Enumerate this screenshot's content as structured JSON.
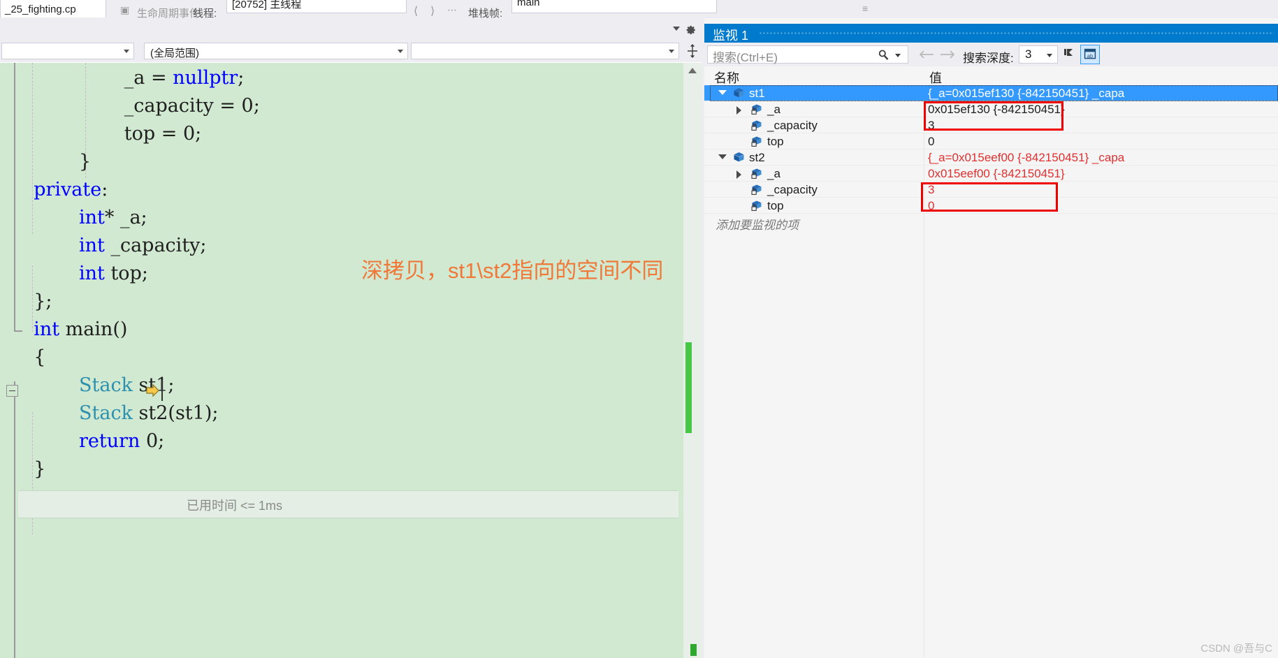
{
  "toolbar": {
    "tab_label": "_25_fighting.cp",
    "auto_window_label": "生命周期事件",
    "thread_label": "线程:",
    "thread_value": "[20752] 主线程",
    "stack_label": "堆栈帧:",
    "stack_value": "main",
    "scope_left": "",
    "scope_global": "(全局范围)",
    "scope_right": ""
  },
  "editor": {
    "lines": [
      {
        "indent": 9,
        "segments": [
          {
            "t": "_a = ",
            "c": "ident"
          },
          {
            "t": "nullptr",
            "c": "kw"
          },
          {
            "t": ";",
            "c": "ident"
          }
        ]
      },
      {
        "indent": 9,
        "segments": [
          {
            "t": "_capacity = 0;",
            "c": "ident"
          }
        ]
      },
      {
        "indent": 9,
        "segments": [
          {
            "t": "top = 0;",
            "c": "ident"
          }
        ]
      },
      {
        "indent": 5,
        "segments": [
          {
            "t": "}",
            "c": "ident"
          }
        ]
      },
      {
        "indent": 1,
        "segments": [
          {
            "t": "private",
            "c": "kw"
          },
          {
            "t": ":",
            "c": "ident"
          }
        ]
      },
      {
        "indent": 5,
        "segments": [
          {
            "t": "int",
            "c": "kw"
          },
          {
            "t": "* _a;",
            "c": "ident"
          }
        ]
      },
      {
        "indent": 5,
        "segments": [
          {
            "t": "int",
            "c": "kw"
          },
          {
            "t": " _capacity;",
            "c": "ident"
          }
        ]
      },
      {
        "indent": 5,
        "segments": [
          {
            "t": "int",
            "c": "kw"
          },
          {
            "t": " top;",
            "c": "ident"
          }
        ]
      },
      {
        "indent": 1,
        "segments": [
          {
            "t": "};",
            "c": "ident"
          }
        ]
      },
      {
        "indent": 1,
        "segments": [
          {
            "t": "int",
            "c": "kw"
          },
          {
            "t": " ",
            "c": "ident"
          },
          {
            "t": "main",
            "c": "ident"
          },
          {
            "t": "()",
            "c": "ident"
          }
        ]
      },
      {
        "indent": 1,
        "segments": [
          {
            "t": "{",
            "c": "ident"
          }
        ]
      },
      {
        "indent": 5,
        "segments": [
          {
            "t": "Stack",
            "c": "ty"
          },
          {
            "t": " st1;",
            "c": "ident"
          }
        ]
      },
      {
        "indent": 5,
        "segments": [
          {
            "t": "Stack",
            "c": "ty"
          },
          {
            "t": " st2(st1);",
            "c": "ident"
          }
        ]
      },
      {
        "indent": 5,
        "segments": [
          {
            "t": "return",
            "c": "kw"
          },
          {
            "t": " 0;",
            "c": "ident"
          }
        ]
      },
      {
        "indent": 1,
        "segments": [
          {
            "t": "}",
            "c": "ident"
          }
        ]
      }
    ],
    "elapsed_text": "已用时间 <= 1ms",
    "annotation_text": "深拷贝，st1\\st2指向的空间不同",
    "annotation_color": "#f07838",
    "background_color": "#d1e8d1"
  },
  "watch": {
    "title": "监视 1",
    "search_placeholder": "搜索(Ctrl+E)",
    "depth_label": "搜索深度:",
    "depth_value": "3",
    "columns": {
      "name": "名称",
      "value": "值"
    },
    "add_item_placeholder": "添加要监视的项",
    "rows": [
      {
        "depth": 0,
        "expander": "open",
        "icon": "object-icon",
        "name": "st1",
        "value": "{_a=0x015ef130 {-842150451} _capa",
        "red": false,
        "selected": true
      },
      {
        "depth": 1,
        "expander": "closed",
        "icon": "field-icon",
        "name": "_a",
        "value": "0x015ef130 {-842150451}",
        "red": false,
        "selected": false
      },
      {
        "depth": 1,
        "expander": "none",
        "icon": "field-icon",
        "name": "_capacity",
        "value": "3",
        "red": false,
        "selected": false
      },
      {
        "depth": 1,
        "expander": "none",
        "icon": "field-icon",
        "name": "top",
        "value": "0",
        "red": false,
        "selected": false
      },
      {
        "depth": 0,
        "expander": "open",
        "icon": "object-icon",
        "name": "st2",
        "value": "{_a=0x015eef00 {-842150451} _capa",
        "red": true,
        "selected": false
      },
      {
        "depth": 1,
        "expander": "closed",
        "icon": "field-icon",
        "name": "_a",
        "value": "0x015eef00 {-842150451}",
        "red": true,
        "selected": false
      },
      {
        "depth": 1,
        "expander": "none",
        "icon": "field-icon",
        "name": "_capacity",
        "value": "3",
        "red": true,
        "selected": false
      },
      {
        "depth": 1,
        "expander": "none",
        "icon": "field-icon",
        "name": "top",
        "value": "0",
        "red": true,
        "selected": false
      }
    ],
    "highlight_boxes": [
      {
        "label": "st1-pointer-highlight"
      },
      {
        "label": "st2-pointer-highlight"
      }
    ]
  },
  "watermark": "CSDN @吾与C"
}
